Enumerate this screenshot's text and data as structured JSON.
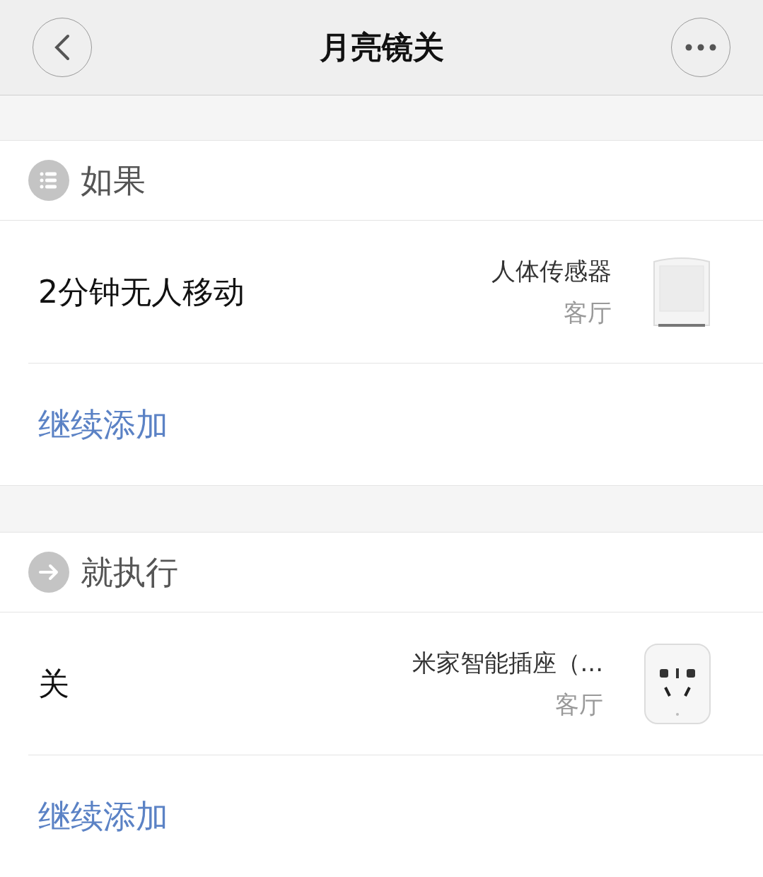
{
  "header": {
    "title": "月亮镜关"
  },
  "sections": [
    {
      "kind": "list",
      "title": "如果",
      "items": [
        {
          "label": "2分钟无人移动",
          "device": "人体传感器",
          "room": "客厅",
          "kind": "sensor"
        }
      ],
      "add_label": "继续添加"
    },
    {
      "kind": "arrow",
      "title": "就执行",
      "items": [
        {
          "label": "关",
          "device": "米家智能插座（...",
          "room": "客厅",
          "kind": "plug"
        }
      ],
      "add_label": "继续添加"
    }
  ]
}
